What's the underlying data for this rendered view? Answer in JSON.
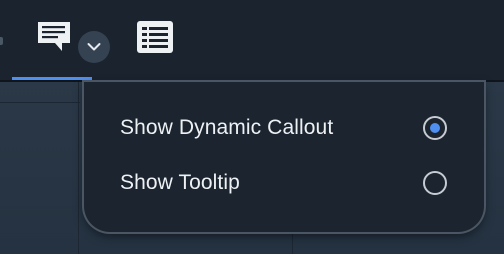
{
  "toolbar": {
    "active_tool": "callout",
    "accent_color": "#4f8ff0",
    "icons": [
      "callout-icon",
      "chevron-down-icon",
      "list-icon"
    ]
  },
  "menu": {
    "items": [
      {
        "label": "Show Dynamic Callout",
        "selected": true
      },
      {
        "label": "Show Tooltip",
        "selected": false
      }
    ]
  }
}
